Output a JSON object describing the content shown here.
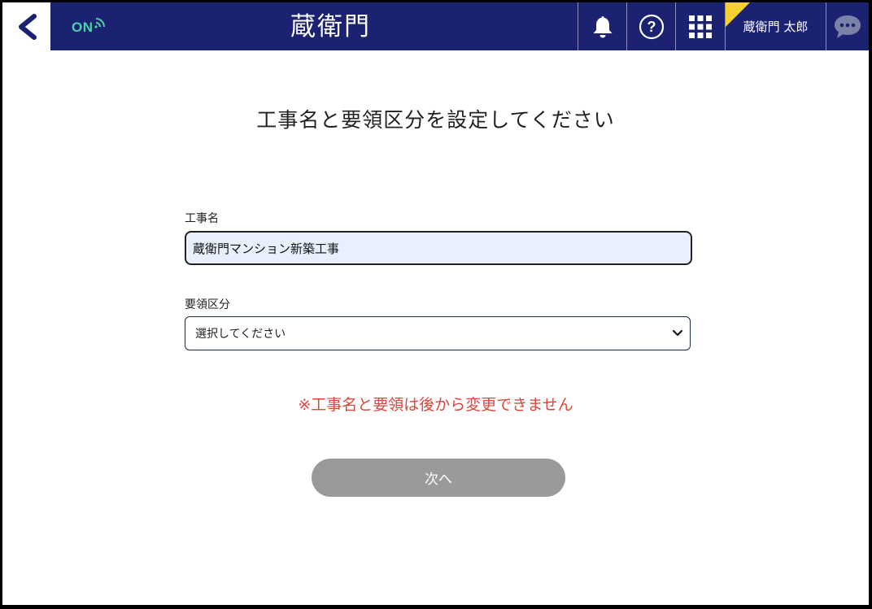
{
  "header": {
    "status": "ON",
    "logo": "蔵衛門",
    "user_name": "蔵衛門 太郎",
    "icons": [
      "back-chevron-icon",
      "wifi-icon",
      "bell-icon",
      "help-icon",
      "apps-grid-icon",
      "chat-bubble-icon"
    ]
  },
  "main": {
    "heading": "工事名と要領区分を設定してください",
    "project_label": "工事名",
    "project_value": "蔵衛門マンション新築工事",
    "category_label": "要領区分",
    "category_selected": "選択してください",
    "warning": "※工事名と要領は後から変更できません",
    "next_label": "次へ"
  },
  "colors": {
    "header_bg": "#1b2272",
    "online": "#4fd0a7",
    "warning": "#d9473d",
    "input_bg": "#e8f0fe",
    "button_disabled": "#9a9a9a",
    "flag": "#f5d130"
  }
}
